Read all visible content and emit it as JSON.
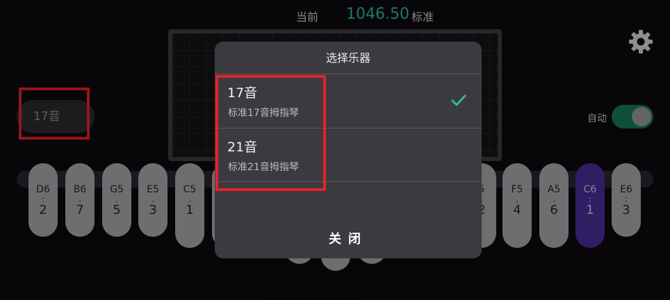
{
  "frequency": {
    "current_label": "当前",
    "value": "1046.50",
    "standard_label": "标准"
  },
  "settings": {
    "icon": "gear-icon"
  },
  "instrument_button": {
    "label": "17音"
  },
  "auto_toggle": {
    "label": "自动",
    "state": "on",
    "accent": "#137a5a"
  },
  "keys_left": [
    {
      "note": "D6",
      "num": "2"
    },
    {
      "note": "B6",
      "num": "7"
    },
    {
      "note": "G5",
      "num": "5"
    },
    {
      "note": "E5",
      "num": "3"
    },
    {
      "note": "C5",
      "num": "1"
    }
  ],
  "keys_right": [
    {
      "note": "5",
      "num": "2"
    },
    {
      "note": "F5",
      "num": "4"
    },
    {
      "note": "A5",
      "num": "6"
    },
    {
      "note": "C6",
      "num": "1",
      "active": true
    },
    {
      "note": "E6",
      "num": "3"
    }
  ],
  "dialog": {
    "title": "选择乐器",
    "options": [
      {
        "name": "17音",
        "desc": "标准17音拇指琴",
        "selected": true
      },
      {
        "name": "21音",
        "desc": "标准21音拇指琴",
        "selected": false
      }
    ],
    "close_label": "关闭"
  },
  "colors": {
    "accent": "#2fb9a0",
    "highlight": "#e2232b",
    "active_key": "#4b2f9a"
  }
}
